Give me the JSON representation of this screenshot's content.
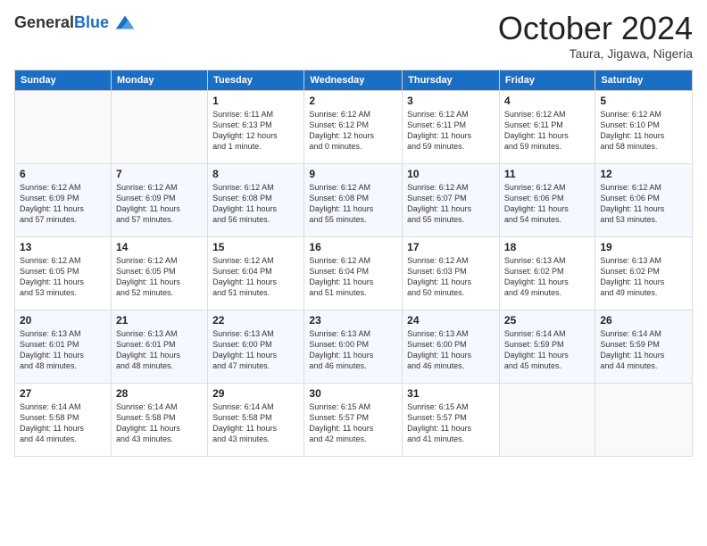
{
  "header": {
    "logo_general": "General",
    "logo_blue": "Blue",
    "month_title": "October 2024",
    "location": "Taura, Jigawa, Nigeria"
  },
  "days_of_week": [
    "Sunday",
    "Monday",
    "Tuesday",
    "Wednesday",
    "Thursday",
    "Friday",
    "Saturday"
  ],
  "weeks": [
    [
      {
        "day": "",
        "info": ""
      },
      {
        "day": "",
        "info": ""
      },
      {
        "day": "1",
        "info": "Sunrise: 6:11 AM\nSunset: 6:13 PM\nDaylight: 12 hours\nand 1 minute."
      },
      {
        "day": "2",
        "info": "Sunrise: 6:12 AM\nSunset: 6:12 PM\nDaylight: 12 hours\nand 0 minutes."
      },
      {
        "day": "3",
        "info": "Sunrise: 6:12 AM\nSunset: 6:11 PM\nDaylight: 11 hours\nand 59 minutes."
      },
      {
        "day": "4",
        "info": "Sunrise: 6:12 AM\nSunset: 6:11 PM\nDaylight: 11 hours\nand 59 minutes."
      },
      {
        "day": "5",
        "info": "Sunrise: 6:12 AM\nSunset: 6:10 PM\nDaylight: 11 hours\nand 58 minutes."
      }
    ],
    [
      {
        "day": "6",
        "info": "Sunrise: 6:12 AM\nSunset: 6:09 PM\nDaylight: 11 hours\nand 57 minutes."
      },
      {
        "day": "7",
        "info": "Sunrise: 6:12 AM\nSunset: 6:09 PM\nDaylight: 11 hours\nand 57 minutes."
      },
      {
        "day": "8",
        "info": "Sunrise: 6:12 AM\nSunset: 6:08 PM\nDaylight: 11 hours\nand 56 minutes."
      },
      {
        "day": "9",
        "info": "Sunrise: 6:12 AM\nSunset: 6:08 PM\nDaylight: 11 hours\nand 55 minutes."
      },
      {
        "day": "10",
        "info": "Sunrise: 6:12 AM\nSunset: 6:07 PM\nDaylight: 11 hours\nand 55 minutes."
      },
      {
        "day": "11",
        "info": "Sunrise: 6:12 AM\nSunset: 6:06 PM\nDaylight: 11 hours\nand 54 minutes."
      },
      {
        "day": "12",
        "info": "Sunrise: 6:12 AM\nSunset: 6:06 PM\nDaylight: 11 hours\nand 53 minutes."
      }
    ],
    [
      {
        "day": "13",
        "info": "Sunrise: 6:12 AM\nSunset: 6:05 PM\nDaylight: 11 hours\nand 53 minutes."
      },
      {
        "day": "14",
        "info": "Sunrise: 6:12 AM\nSunset: 6:05 PM\nDaylight: 11 hours\nand 52 minutes."
      },
      {
        "day": "15",
        "info": "Sunrise: 6:12 AM\nSunset: 6:04 PM\nDaylight: 11 hours\nand 51 minutes."
      },
      {
        "day": "16",
        "info": "Sunrise: 6:12 AM\nSunset: 6:04 PM\nDaylight: 11 hours\nand 51 minutes."
      },
      {
        "day": "17",
        "info": "Sunrise: 6:12 AM\nSunset: 6:03 PM\nDaylight: 11 hours\nand 50 minutes."
      },
      {
        "day": "18",
        "info": "Sunrise: 6:13 AM\nSunset: 6:02 PM\nDaylight: 11 hours\nand 49 minutes."
      },
      {
        "day": "19",
        "info": "Sunrise: 6:13 AM\nSunset: 6:02 PM\nDaylight: 11 hours\nand 49 minutes."
      }
    ],
    [
      {
        "day": "20",
        "info": "Sunrise: 6:13 AM\nSunset: 6:01 PM\nDaylight: 11 hours\nand 48 minutes."
      },
      {
        "day": "21",
        "info": "Sunrise: 6:13 AM\nSunset: 6:01 PM\nDaylight: 11 hours\nand 48 minutes."
      },
      {
        "day": "22",
        "info": "Sunrise: 6:13 AM\nSunset: 6:00 PM\nDaylight: 11 hours\nand 47 minutes."
      },
      {
        "day": "23",
        "info": "Sunrise: 6:13 AM\nSunset: 6:00 PM\nDaylight: 11 hours\nand 46 minutes."
      },
      {
        "day": "24",
        "info": "Sunrise: 6:13 AM\nSunset: 6:00 PM\nDaylight: 11 hours\nand 46 minutes."
      },
      {
        "day": "25",
        "info": "Sunrise: 6:14 AM\nSunset: 5:59 PM\nDaylight: 11 hours\nand 45 minutes."
      },
      {
        "day": "26",
        "info": "Sunrise: 6:14 AM\nSunset: 5:59 PM\nDaylight: 11 hours\nand 44 minutes."
      }
    ],
    [
      {
        "day": "27",
        "info": "Sunrise: 6:14 AM\nSunset: 5:58 PM\nDaylight: 11 hours\nand 44 minutes."
      },
      {
        "day": "28",
        "info": "Sunrise: 6:14 AM\nSunset: 5:58 PM\nDaylight: 11 hours\nand 43 minutes."
      },
      {
        "day": "29",
        "info": "Sunrise: 6:14 AM\nSunset: 5:58 PM\nDaylight: 11 hours\nand 43 minutes."
      },
      {
        "day": "30",
        "info": "Sunrise: 6:15 AM\nSunset: 5:57 PM\nDaylight: 11 hours\nand 42 minutes."
      },
      {
        "day": "31",
        "info": "Sunrise: 6:15 AM\nSunset: 5:57 PM\nDaylight: 11 hours\nand 41 minutes."
      },
      {
        "day": "",
        "info": ""
      },
      {
        "day": "",
        "info": ""
      }
    ]
  ]
}
